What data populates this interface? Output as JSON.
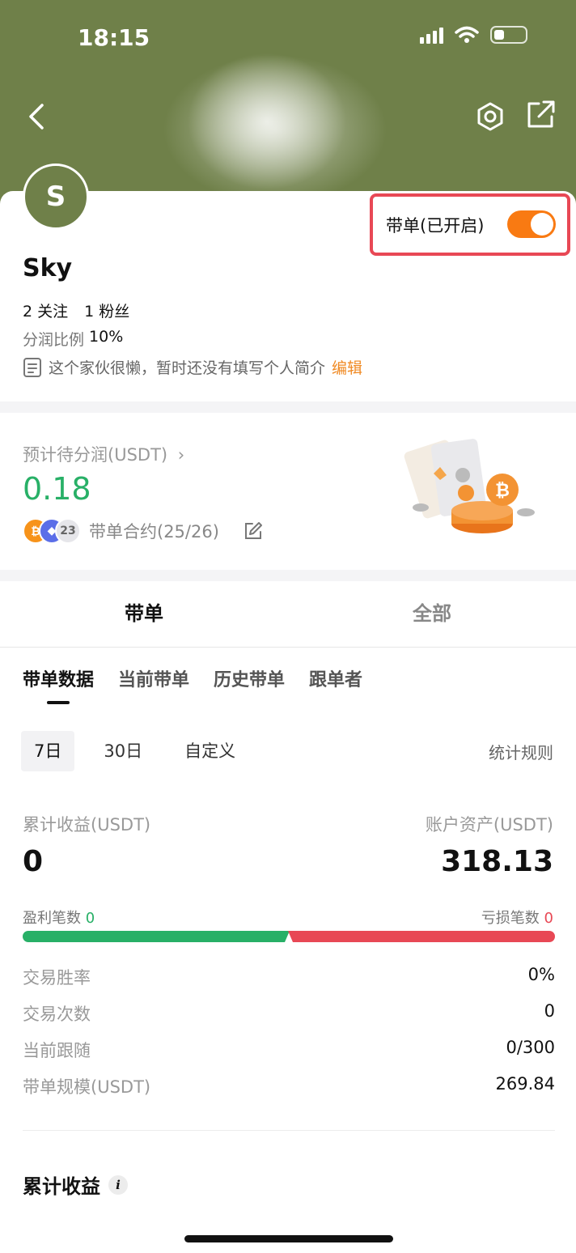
{
  "status": {
    "time": "18:15"
  },
  "profile": {
    "avatar_letter": "S",
    "name": "Sky",
    "following": "2 关注",
    "followers": "1 粉丝",
    "profit_share_label": "分润比例",
    "profit_share_value": "10%",
    "bio": "这个家伙很懒，暂时还没有填写个人简介",
    "edit_label": "编辑"
  },
  "lead_toggle": {
    "label": "带单(已开启)",
    "on": true,
    "accent": "#f97a12"
  },
  "estimate": {
    "label": "预计待分润(USDT)",
    "value": "0.18",
    "coin_count": "23",
    "contract_label": "带单合约(25/26)"
  },
  "main_tabs": [
    {
      "label": "带单"
    },
    {
      "label": "全部"
    }
  ],
  "sub_tabs": [
    {
      "label": "带单数据"
    },
    {
      "label": "当前带单"
    },
    {
      "label": "历史带单"
    },
    {
      "label": "跟单者"
    }
  ],
  "periods": [
    {
      "label": "7日"
    },
    {
      "label": "30日"
    },
    {
      "label": "自定义"
    }
  ],
  "stat_rules_label": "统计规则",
  "summary": {
    "cum_label": "累计收益(USDT)",
    "cum_value": "0",
    "asset_label": "账户资产(USDT)",
    "asset_value": "318.13",
    "win_label": "盈利笔数",
    "win_count": "0",
    "loss_label": "亏损笔数",
    "loss_count": "0",
    "win_share": 0.5
  },
  "stats": [
    {
      "k": "交易胜率",
      "v": "0%"
    },
    {
      "k": "交易次数",
      "v": "0"
    },
    {
      "k": "当前跟随",
      "v": "0/300"
    },
    {
      "k": "带单规模(USDT)",
      "v": "269.84"
    }
  ],
  "section_title": "累计收益",
  "colors": {
    "green": "#28b067",
    "red": "#e84855",
    "header": "#6f8049",
    "orange": "#f08a24"
  }
}
